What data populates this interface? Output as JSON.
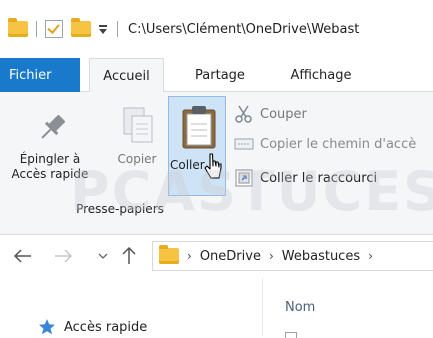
{
  "title_bar": {
    "path": "C:\\Users\\Clément\\OneDrive\\Webast"
  },
  "tabs": {
    "file": "Fichier",
    "home": "Accueil",
    "share": "Partage",
    "view": "Affichage"
  },
  "ribbon": {
    "pin_label_line1": "Épingler à",
    "pin_label_line2": "Accès rapide",
    "copy_label": "Copier",
    "paste_label": "Coller",
    "cut_label": "Couper",
    "copy_path_label": "Copier le chemin d'accè",
    "paste_shortcut_label": "Coller le raccourci",
    "group_label": "Presse-papiers"
  },
  "address": {
    "crumbs": [
      "OneDrive",
      "Webastuces"
    ]
  },
  "navigation": {
    "quick_access": "Accès rapide"
  },
  "file_list": {
    "name_header": "Nom"
  },
  "watermark": {
    "text": "PCASTUCES"
  },
  "colors": {
    "file_tab": "#1979ca",
    "folder": "#f6c342",
    "pin": "#5a86c7"
  }
}
